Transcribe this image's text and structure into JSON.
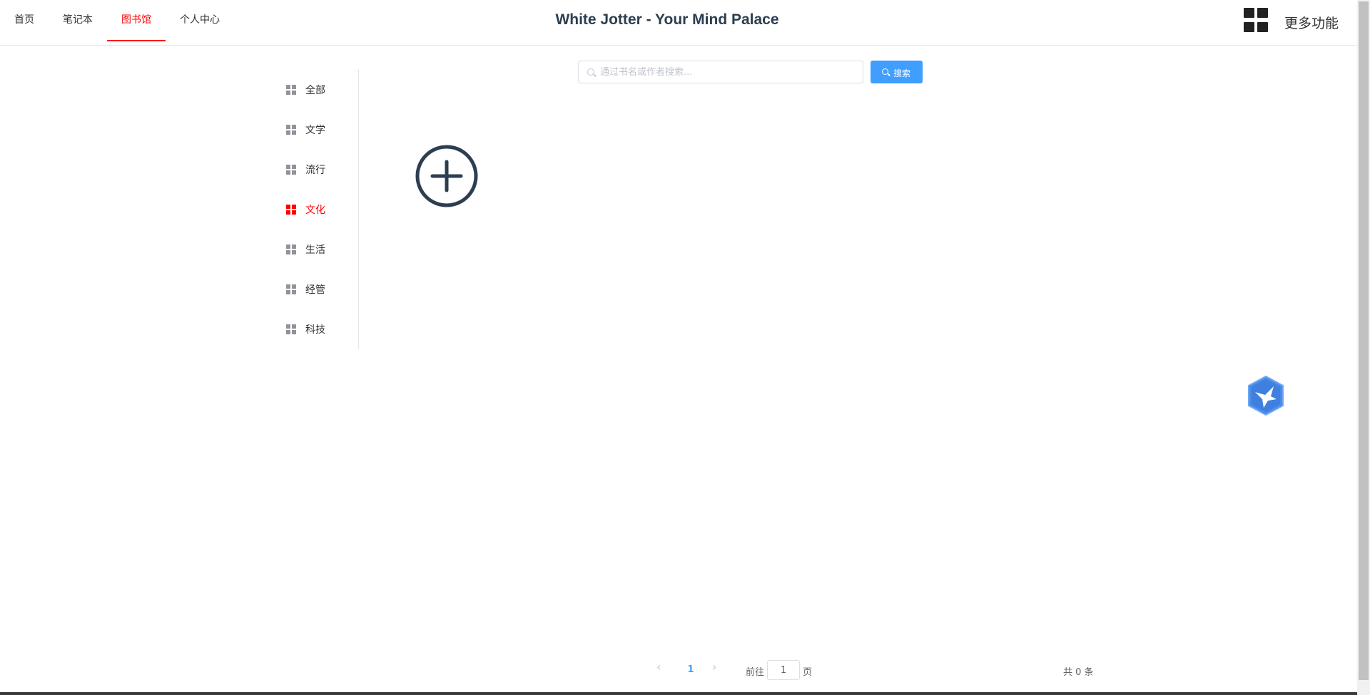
{
  "nav": {
    "items": [
      {
        "label": "首页"
      },
      {
        "label": "笔记本"
      },
      {
        "label": "图书馆"
      },
      {
        "label": "个人中心"
      }
    ],
    "active_index": 2
  },
  "header": {
    "title": "White Jotter - Your Mind Palace",
    "more_label": "更多功能",
    "more_icon": "grid-icon"
  },
  "side_menu": {
    "items": [
      {
        "label": "全部"
      },
      {
        "label": "文学"
      },
      {
        "label": "流行"
      },
      {
        "label": "文化"
      },
      {
        "label": "生活"
      },
      {
        "label": "经管"
      },
      {
        "label": "科技"
      }
    ],
    "active_index": 3,
    "item_icon": "menu-grid-icon"
  },
  "search": {
    "placeholder": "通过书名或作者搜索...",
    "value": "",
    "button_label": "搜索"
  },
  "add_button": {
    "icon": "plus-circle-icon"
  },
  "floating_widget": {
    "icon": "bird-icon"
  },
  "pagination": {
    "prev_icon": "‹",
    "current_page": "1",
    "next_icon": "›",
    "goto_label": "前往",
    "goto_value": "1",
    "page_suffix": "页",
    "total_text": "共 0 条"
  },
  "colors": {
    "accent": "#ff0000",
    "primary": "#409eff",
    "text": "#303133",
    "title": "#2c3e50"
  }
}
